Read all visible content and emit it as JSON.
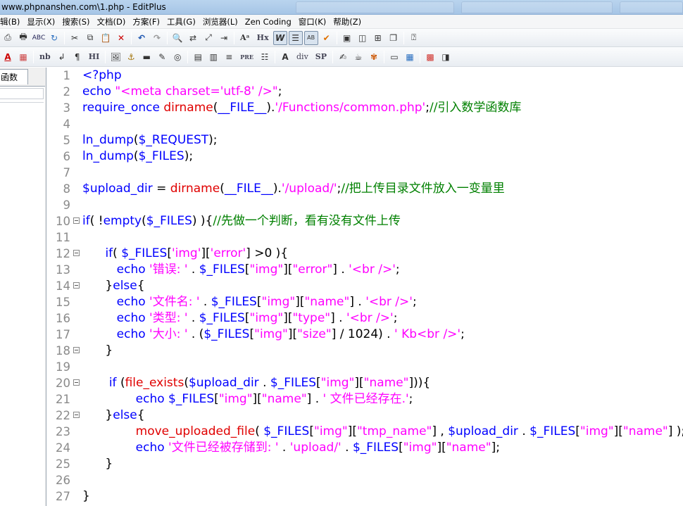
{
  "window": {
    "title": "www.phpnanshen.com\\1.php - EditPlus"
  },
  "menu": [
    "辑(B)",
    "显示(X)",
    "搜索(S)",
    "文档(D)",
    "方案(F)",
    "工具(G)",
    "浏览器(L)",
    "Zen Coding",
    "窗口(K)",
    "帮助(Z)"
  ],
  "toolbar2_text": {
    "nb": "nb",
    "hi": "HI",
    "pre": "PRE",
    "div": "div",
    "sp": "SP",
    "hx": "Hx"
  },
  "left_panel": {
    "tab_label": "函数"
  },
  "colors": {
    "keyword": "#0000ff",
    "string": "#ff00ff",
    "function": "#e00000",
    "comment": "#008000"
  },
  "editor": {
    "lines": [
      {
        "n": "1",
        "tokens": [
          [
            "c-kw",
            "<?php"
          ]
        ]
      },
      {
        "n": "2",
        "tokens": [
          [
            "c-kw",
            "echo "
          ],
          [
            "c-str",
            "\"<meta charset='utf-8' />\""
          ],
          [
            "c-bl",
            ";"
          ]
        ]
      },
      {
        "n": "3",
        "tokens": [
          [
            "c-kw",
            "require_once "
          ],
          [
            "c-fn",
            "dirname"
          ],
          [
            "c-bl",
            "("
          ],
          [
            "c-kw",
            "__FILE__"
          ],
          [
            "c-bl",
            ")."
          ],
          [
            "c-str",
            "'/Functions/common.php'"
          ],
          [
            "c-bl",
            ";"
          ],
          [
            "c-cm",
            "//引入数学函数库"
          ]
        ]
      },
      {
        "n": "4",
        "tokens": []
      },
      {
        "n": "5",
        "tokens": [
          [
            "c-kw",
            "ln_dump"
          ],
          [
            "c-bl",
            "("
          ],
          [
            "c-var",
            "$_REQUEST"
          ],
          [
            "c-bl",
            ");"
          ]
        ]
      },
      {
        "n": "6",
        "tokens": [
          [
            "c-kw",
            "ln_dump"
          ],
          [
            "c-bl",
            "("
          ],
          [
            "c-var",
            "$_FILES"
          ],
          [
            "c-bl",
            ");"
          ]
        ]
      },
      {
        "n": "7",
        "tokens": []
      },
      {
        "n": "8",
        "tokens": [
          [
            "c-var",
            "$upload_dir"
          ],
          [
            "c-bl",
            " = "
          ],
          [
            "c-fn",
            "dirname"
          ],
          [
            "c-bl",
            "("
          ],
          [
            "c-kw",
            "__FILE__"
          ],
          [
            "c-bl",
            ")."
          ],
          [
            "c-str",
            "'/upload/'"
          ],
          [
            "c-bl",
            ";"
          ],
          [
            "c-cm",
            "//把上传目录文件放入一变量里"
          ]
        ]
      },
      {
        "n": "9",
        "tokens": []
      },
      {
        "n": "10",
        "fold": true,
        "tokens": [
          [
            "c-kw",
            "if"
          ],
          [
            "c-bl",
            "( !"
          ],
          [
            "c-kw",
            "empty"
          ],
          [
            "c-bl",
            "("
          ],
          [
            "c-var",
            "$_FILES"
          ],
          [
            "c-bl",
            ") ){"
          ],
          [
            "c-cm",
            "//先做一个判断，看有没有文件上传"
          ]
        ]
      },
      {
        "n": "11",
        "tokens": []
      },
      {
        "n": "12",
        "fold": true,
        "tokens": [
          [
            "c-bl",
            "      "
          ],
          [
            "c-kw",
            "if"
          ],
          [
            "c-bl",
            "( "
          ],
          [
            "c-var",
            "$_FILES"
          ],
          [
            "c-bl",
            "["
          ],
          [
            "c-str",
            "'img'"
          ],
          [
            "c-bl",
            "]["
          ],
          [
            "c-str",
            "'error'"
          ],
          [
            "c-bl",
            "] >0 ){"
          ]
        ]
      },
      {
        "n": "13",
        "tokens": [
          [
            "c-bl",
            "         "
          ],
          [
            "c-kw",
            "echo "
          ],
          [
            "c-str",
            "'错误: '"
          ],
          [
            "c-bl",
            " . "
          ],
          [
            "c-var",
            "$_FILES"
          ],
          [
            "c-bl",
            "["
          ],
          [
            "c-str",
            "\"img\""
          ],
          [
            "c-bl",
            "]["
          ],
          [
            "c-str",
            "\"error\""
          ],
          [
            "c-bl",
            "] . "
          ],
          [
            "c-str",
            "'<br />'"
          ],
          [
            "c-bl",
            ";"
          ]
        ]
      },
      {
        "n": "14",
        "fold": true,
        "tokens": [
          [
            "c-bl",
            "      }"
          ],
          [
            "c-kw",
            "else"
          ],
          [
            "c-bl",
            "{"
          ]
        ]
      },
      {
        "n": "15",
        "tokens": [
          [
            "c-bl",
            "         "
          ],
          [
            "c-kw",
            "echo "
          ],
          [
            "c-str",
            "'文件名: '"
          ],
          [
            "c-bl",
            " . "
          ],
          [
            "c-var",
            "$_FILES"
          ],
          [
            "c-bl",
            "["
          ],
          [
            "c-str",
            "\"img\""
          ],
          [
            "c-bl",
            "]["
          ],
          [
            "c-str",
            "\"name\""
          ],
          [
            "c-bl",
            "] . "
          ],
          [
            "c-str",
            "'<br />'"
          ],
          [
            "c-bl",
            ";"
          ]
        ]
      },
      {
        "n": "16",
        "tokens": [
          [
            "c-bl",
            "         "
          ],
          [
            "c-kw",
            "echo "
          ],
          [
            "c-str",
            "'类型: '"
          ],
          [
            "c-bl",
            " . "
          ],
          [
            "c-var",
            "$_FILES"
          ],
          [
            "c-bl",
            "["
          ],
          [
            "c-str",
            "\"img\""
          ],
          [
            "c-bl",
            "]["
          ],
          [
            "c-str",
            "\"type\""
          ],
          [
            "c-bl",
            "] . "
          ],
          [
            "c-str",
            "'<br />'"
          ],
          [
            "c-bl",
            ";"
          ]
        ]
      },
      {
        "n": "17",
        "tokens": [
          [
            "c-bl",
            "         "
          ],
          [
            "c-kw",
            "echo "
          ],
          [
            "c-str",
            "'大小: '"
          ],
          [
            "c-bl",
            " . ("
          ],
          [
            "c-var",
            "$_FILES"
          ],
          [
            "c-bl",
            "["
          ],
          [
            "c-str",
            "\"img\""
          ],
          [
            "c-bl",
            "]["
          ],
          [
            "c-str",
            "\"size\""
          ],
          [
            "c-bl",
            "] / 1024) . "
          ],
          [
            "c-str",
            "' Kb<br />'"
          ],
          [
            "c-bl",
            ";"
          ]
        ]
      },
      {
        "n": "18",
        "fold": true,
        "tokens": [
          [
            "c-bl",
            "      }"
          ]
        ]
      },
      {
        "n": "19",
        "tokens": []
      },
      {
        "n": "20",
        "fold": true,
        "tokens": [
          [
            "c-bl",
            "       "
          ],
          [
            "c-kw",
            "if "
          ],
          [
            "c-bl",
            "("
          ],
          [
            "c-fn",
            "file_exists"
          ],
          [
            "c-bl",
            "("
          ],
          [
            "c-var",
            "$upload_dir"
          ],
          [
            "c-bl",
            " . "
          ],
          [
            "c-var",
            "$_FILES"
          ],
          [
            "c-bl",
            "["
          ],
          [
            "c-str",
            "\"img\""
          ],
          [
            "c-bl",
            "]["
          ],
          [
            "c-str",
            "\"name\""
          ],
          [
            "c-bl",
            "])){"
          ]
        ]
      },
      {
        "n": "21",
        "tokens": [
          [
            "c-bl",
            "              "
          ],
          [
            "c-kw",
            "echo "
          ],
          [
            "c-var",
            "$_FILES"
          ],
          [
            "c-bl",
            "["
          ],
          [
            "c-str",
            "\"img\""
          ],
          [
            "c-bl",
            "]["
          ],
          [
            "c-str",
            "\"name\""
          ],
          [
            "c-bl",
            "] . "
          ],
          [
            "c-str",
            "' 文件已经存在.'"
          ],
          [
            "c-bl",
            ";"
          ]
        ]
      },
      {
        "n": "22",
        "fold": true,
        "tokens": [
          [
            "c-bl",
            "      }"
          ],
          [
            "c-kw",
            "else"
          ],
          [
            "c-bl",
            "{"
          ]
        ]
      },
      {
        "n": "23",
        "tokens": [
          [
            "c-bl",
            "              "
          ],
          [
            "c-fn",
            "move_uploaded_file"
          ],
          [
            "c-bl",
            "( "
          ],
          [
            "c-var",
            "$_FILES"
          ],
          [
            "c-bl",
            "["
          ],
          [
            "c-str",
            "\"img\""
          ],
          [
            "c-bl",
            "]["
          ],
          [
            "c-str",
            "\"tmp_name\""
          ],
          [
            "c-bl",
            "] , "
          ],
          [
            "c-var",
            "$upload_dir"
          ],
          [
            "c-bl",
            " . "
          ],
          [
            "c-var",
            "$_FILES"
          ],
          [
            "c-bl",
            "["
          ],
          [
            "c-str",
            "\"img\""
          ],
          [
            "c-bl",
            "]["
          ],
          [
            "c-str",
            "\"name\""
          ],
          [
            "c-bl",
            "] );"
          ]
        ]
      },
      {
        "n": "24",
        "tokens": [
          [
            "c-bl",
            "              "
          ],
          [
            "c-kw",
            "echo "
          ],
          [
            "c-str",
            "'文件已经被存储到: '"
          ],
          [
            "c-bl",
            " . "
          ],
          [
            "c-str",
            "'upload/'"
          ],
          [
            "c-bl",
            " . "
          ],
          [
            "c-var",
            "$_FILES"
          ],
          [
            "c-bl",
            "["
          ],
          [
            "c-str",
            "\"img\""
          ],
          [
            "c-bl",
            "]["
          ],
          [
            "c-str",
            "\"name\""
          ],
          [
            "c-bl",
            "];"
          ]
        ]
      },
      {
        "n": "25",
        "tokens": [
          [
            "c-bl",
            "      }"
          ]
        ]
      },
      {
        "n": "26",
        "tokens": []
      },
      {
        "n": "27",
        "tokens": [
          [
            "c-bl",
            "}"
          ]
        ]
      }
    ]
  }
}
